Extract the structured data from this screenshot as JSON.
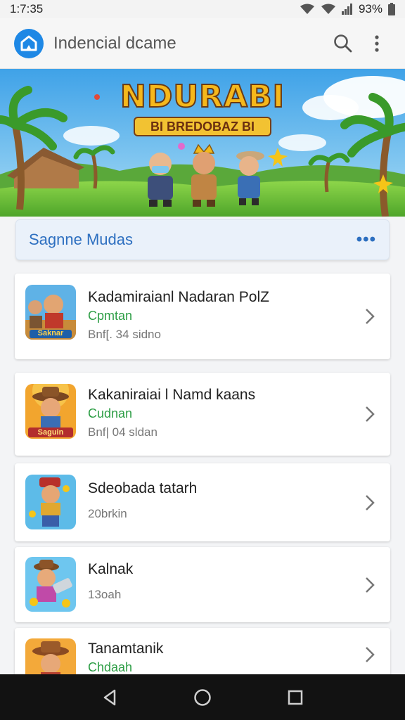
{
  "status": {
    "time": "1:7:35",
    "battery": "93%"
  },
  "app": {
    "title": "Indencial dcame"
  },
  "banner": {
    "title": "NDURABI",
    "subtitle": "BI BREDOBAZ BI"
  },
  "section": {
    "title": "Sagnne Mudas",
    "more": "•••"
  },
  "items": [
    {
      "name": "Kadamiraianl Nadaran PolZ",
      "sub": "Cpmtan",
      "meta": "Bnf[. 34 sidno",
      "icon_label": "Saknar"
    },
    {
      "name": "Kakaniraiai l Namd kaans",
      "sub": "Cudnan",
      "meta": "Bnf| 04 sldan",
      "icon_label": "Saguin"
    },
    {
      "name": "Sdeobada tatarh",
      "sub": "",
      "meta": "20brkin",
      "icon_label": ""
    },
    {
      "name": "Kalnak",
      "sub": "",
      "meta": "13oah",
      "icon_label": ""
    },
    {
      "name": "Tanamtanik",
      "sub": "Chdaah",
      "meta": "",
      "icon_label": ""
    }
  ]
}
